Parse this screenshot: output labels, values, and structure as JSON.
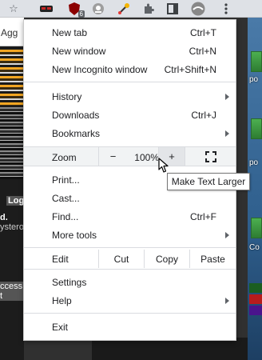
{
  "toolbar": {
    "icons": [
      "star-icon",
      "mask-extension-icon",
      "ublock-extension-icon",
      "shield-extension-icon",
      "eyedropper-extension-icon",
      "extensions-puzzle-icon",
      "side-panel-icon",
      "profile-avatar-icon",
      "more-menu-icon"
    ],
    "ublock_badge": "6"
  },
  "background_page": {
    "bookmark_fragment": "Agg",
    "label_log": "Log",
    "label_d": "d.",
    "label_ystero": "ystero",
    "label_ccess": "ccess t",
    "desktop_labels": [
      "po",
      "po",
      "Co"
    ]
  },
  "menu": {
    "new_tab": {
      "label": "New tab",
      "shortcut": "Ctrl+T"
    },
    "new_window": {
      "label": "New window",
      "shortcut": "Ctrl+N"
    },
    "new_incognito": {
      "label": "New Incognito window",
      "shortcut": "Ctrl+Shift+N"
    },
    "history": {
      "label": "History"
    },
    "downloads": {
      "label": "Downloads",
      "shortcut": "Ctrl+J"
    },
    "bookmarks": {
      "label": "Bookmarks"
    },
    "zoom": {
      "label": "Zoom",
      "minus": "−",
      "value": "100%",
      "plus": "+"
    },
    "print": {
      "label": "Print..."
    },
    "cast": {
      "label": "Cast..."
    },
    "find": {
      "label": "Find...",
      "shortcut": "Ctrl+F"
    },
    "more_tools": {
      "label": "More tools"
    },
    "edit": {
      "label": "Edit",
      "cut": "Cut",
      "copy": "Copy",
      "paste": "Paste"
    },
    "settings": {
      "label": "Settings"
    },
    "help": {
      "label": "Help"
    },
    "exit": {
      "label": "Exit"
    }
  },
  "tooltip": {
    "text": "Make Text Larger"
  },
  "colors": {
    "menu_bg": "#ffffff",
    "separator": "#dadce0",
    "zoom_row_bg": "#f1f3f4",
    "toolbar_bg": "#dee1e6"
  }
}
